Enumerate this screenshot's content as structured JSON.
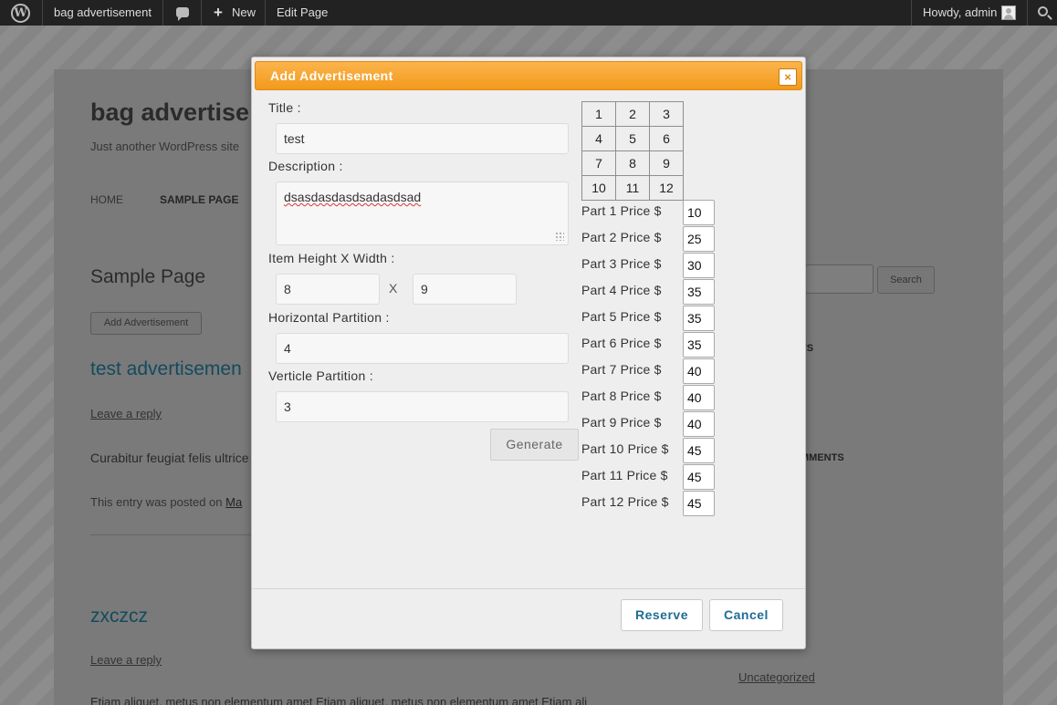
{
  "adminbar": {
    "logo_glyph": "W",
    "site_name": "bag advertisement",
    "new_label": "New",
    "new_glyph": "+",
    "edit_label": "Edit Page",
    "howdy": "Howdy, admin"
  },
  "site": {
    "title": "bag advertise",
    "tagline": "Just another WordPress site",
    "nav": [
      "HOME",
      "SAMPLE PAGE"
    ],
    "page_heading": "Sample Page",
    "add_button": "Add Advertisement",
    "post1_title": "test advertisemen",
    "leave_reply": "Leave a reply",
    "excerpt1": "Curabitur feugiat felis ultrice",
    "entry_meta_prefix": "This entry was posted on",
    "entry_meta_link": "Ma",
    "post2_title": "zxczcz",
    "leave_reply2": "Leave a reply",
    "uncategorized": "Uncategorized",
    "excerpt2": "Etiam aliquet, metus non elementum amet Etiam aliquet, metus non elementum amet Etiam ali",
    "search_button": "Search",
    "widget_frag1": "TS",
    "widget_frag2": "MMENTS"
  },
  "dialog": {
    "title": "Add Advertisement",
    "close_glyph": "×",
    "title_label": "Title :",
    "title_value": "test",
    "description_label": "Description :",
    "description_value": "dsasdasdasdsadasdsad",
    "size_label": "Item Height X Width :",
    "height_value": "8",
    "x_label": "X",
    "width_value": "9",
    "horizontal_label": "Horizontal Partition :",
    "horizontal_value": "4",
    "verticle_label": "Verticle Partition :",
    "verticle_value": "3",
    "generate_label": "Generate",
    "grid": [
      [
        "1",
        "2",
        "3"
      ],
      [
        "4",
        "5",
        "6"
      ],
      [
        "7",
        "8",
        "9"
      ],
      [
        "10",
        "11",
        "12"
      ]
    ],
    "prices": [
      {
        "label": "Part 1 Price $",
        "value": "10"
      },
      {
        "label": "Part 2 Price $",
        "value": "25"
      },
      {
        "label": "Part 3 Price $",
        "value": "30"
      },
      {
        "label": "Part 4 Price $",
        "value": "35"
      },
      {
        "label": "Part 5 Price $",
        "value": "35"
      },
      {
        "label": "Part 6 Price $",
        "value": "35"
      },
      {
        "label": "Part 7 Price $",
        "value": "40"
      },
      {
        "label": "Part 8 Price $",
        "value": "40"
      },
      {
        "label": "Part 9 Price $",
        "value": "40"
      },
      {
        "label": "Part 10 Price $",
        "value": "45"
      },
      {
        "label": "Part 11 Price $",
        "value": "45"
      },
      {
        "label": "Part 12 Price $",
        "value": "45"
      }
    ],
    "reserve_label": "Reserve",
    "cancel_label": "Cancel"
  },
  "colors": {
    "titlebar_orange": "#f5a12a",
    "link_blue": "#1e6d94",
    "adminbar_bg": "#222222"
  }
}
